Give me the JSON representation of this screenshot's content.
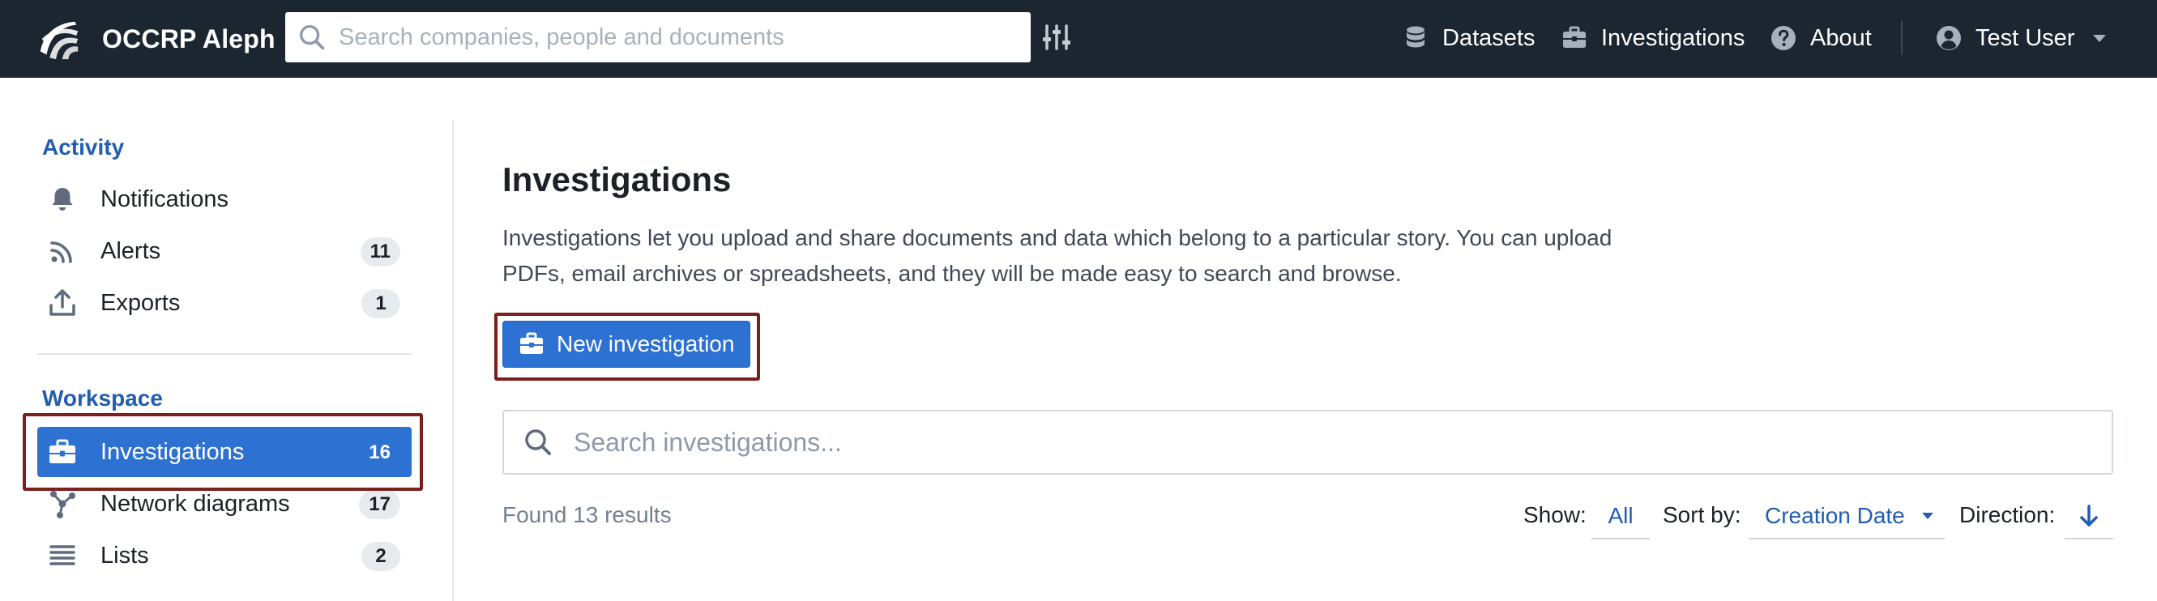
{
  "navbar": {
    "brand": "OCCRP Aleph",
    "search_placeholder": "Search companies, people and documents",
    "links": {
      "datasets": "Datasets",
      "investigations": "Investigations",
      "about": "About"
    },
    "user": "Test User"
  },
  "sidebar": {
    "activity_title": "Activity",
    "activity_items": [
      {
        "label": "Notifications",
        "icon": "bell-icon",
        "count": ""
      },
      {
        "label": "Alerts",
        "icon": "rss-icon",
        "count": "11"
      },
      {
        "label": "Exports",
        "icon": "export-icon",
        "count": "1"
      }
    ],
    "workspace_title": "Workspace",
    "workspace_items": [
      {
        "label": "Investigations",
        "icon": "briefcase-icon",
        "count": "16",
        "active": true
      },
      {
        "label": "Network diagrams",
        "icon": "graph-icon",
        "count": "17"
      },
      {
        "label": "Lists",
        "icon": "list-icon",
        "count": "2"
      }
    ]
  },
  "main": {
    "title": "Investigations",
    "description": "Investigations let you upload and share documents and data which belong to a particular story. You can upload PDFs, email archives or spreadsheets, and they will be made easy to search and browse.",
    "new_button": "New investigation",
    "search_placeholder": "Search investigations...",
    "result_count": "Found 13 results",
    "show_label": "Show:",
    "show_value": "All",
    "sort_label": "Sort by:",
    "sort_value": "Creation Date",
    "direction_label": "Direction:"
  },
  "colors": {
    "navbar_bg": "#1b2631",
    "accent": "#2d72d2",
    "section_title": "#215db0",
    "highlight_border": "#7d1f1f"
  }
}
